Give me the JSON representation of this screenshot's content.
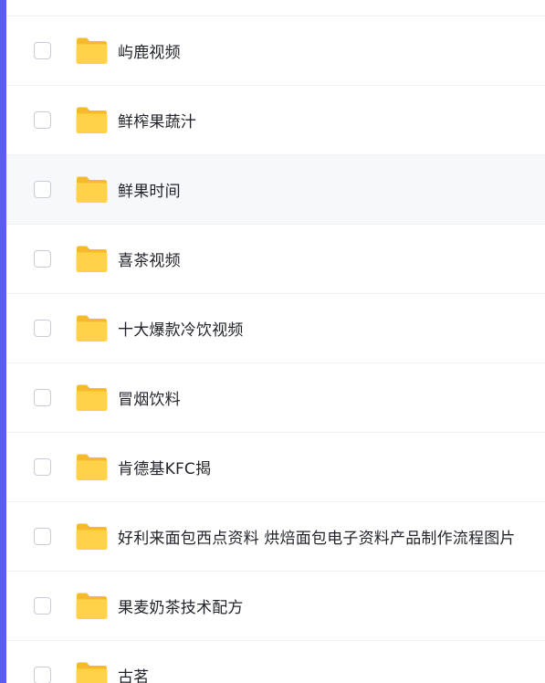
{
  "colors": {
    "accent_bar": "#5b5cf6",
    "folder_back": "#f6b92b",
    "folder_front": "#ffd24a",
    "row_highlight": "#f7f8fc"
  },
  "icons": {
    "checkbox": "checkbox-icon",
    "folder": "folder-icon"
  },
  "files": [
    {
      "name": "",
      "highlighted": false
    },
    {
      "name": "屿鹿视频",
      "highlighted": false
    },
    {
      "name": "鲜榨果蔬汁",
      "highlighted": false
    },
    {
      "name": "鲜果时间",
      "highlighted": true
    },
    {
      "name": "喜茶视频",
      "highlighted": false
    },
    {
      "name": "十大爆款冷饮视频",
      "highlighted": false
    },
    {
      "name": "冒烟饮料",
      "highlighted": false
    },
    {
      "name": "肯德基KFC揭",
      "highlighted": false
    },
    {
      "name": "好利来面包西点资料 烘焙面包电子资料产品制作流程图片",
      "highlighted": false
    },
    {
      "name": "果麦奶茶技术配方",
      "highlighted": false
    },
    {
      "name": "古茗",
      "highlighted": false
    }
  ]
}
